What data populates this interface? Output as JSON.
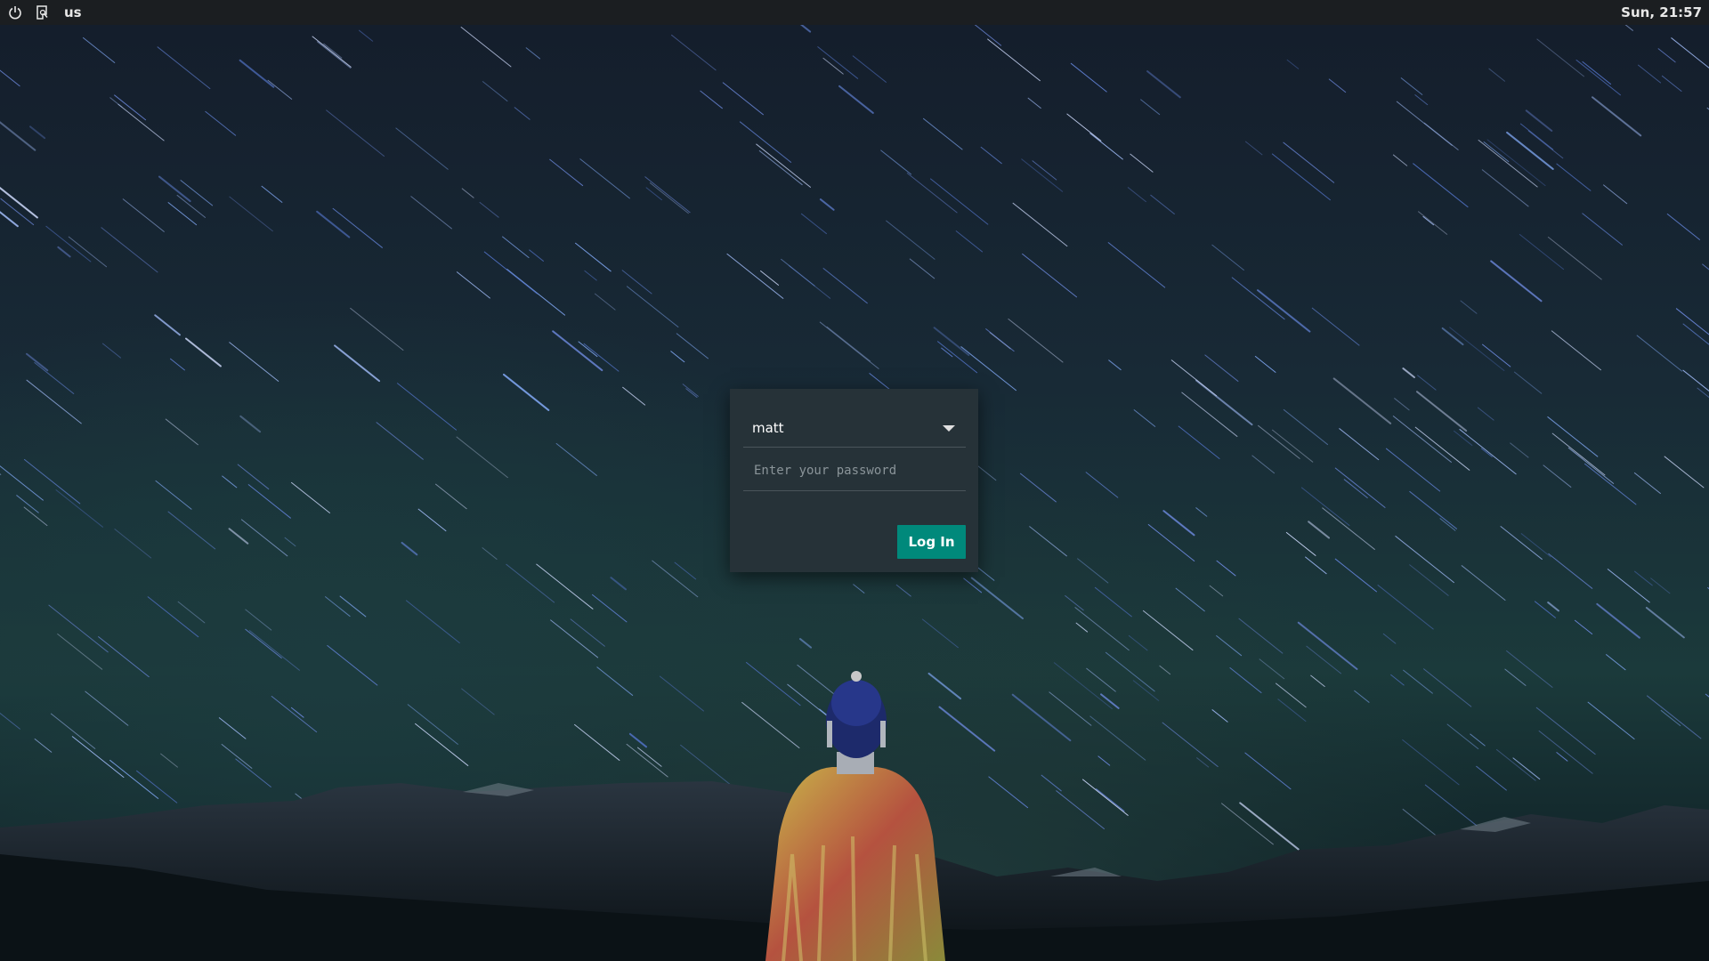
{
  "topbar": {
    "icons": [
      "power-icon",
      "accessibility-icon"
    ],
    "layout": "us",
    "clock": "Sun, 21:57"
  },
  "login": {
    "selected_user": "matt",
    "password_placeholder": "Enter your password",
    "login_button": "Log In",
    "accent_color": "#00897b",
    "card_color": "#263238"
  }
}
